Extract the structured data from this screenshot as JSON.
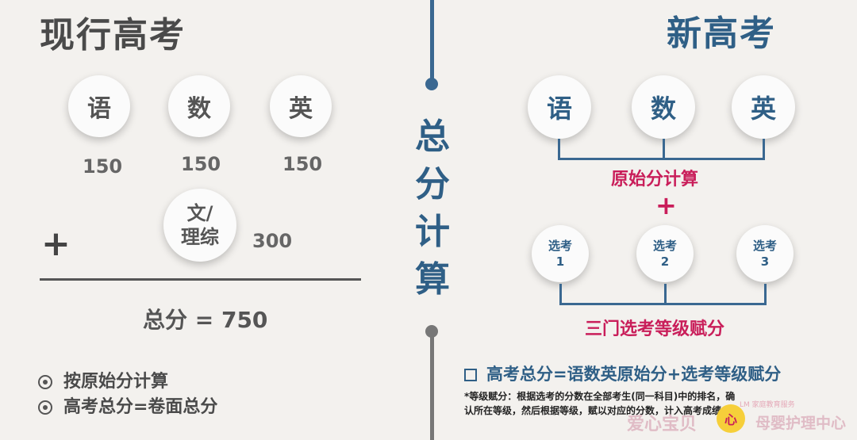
{
  "left": {
    "title": "现行高考",
    "subjects": [
      {
        "label": "语",
        "score": "150"
      },
      {
        "label": "数",
        "score": "150"
      },
      {
        "label": "英",
        "score": "150"
      }
    ],
    "plus": "+",
    "combo_line1": "文/",
    "combo_line2": "理综",
    "combo_score": "300",
    "total": "总分 = 750",
    "notes": [
      "按原始分计算",
      "高考总分=卷面总分"
    ]
  },
  "center": {
    "chars": [
      "总",
      "分",
      "计",
      "算"
    ]
  },
  "right": {
    "title": "新高考",
    "subjects": [
      "语",
      "数",
      "英"
    ],
    "raw_label": "原始分计算",
    "plus": "+",
    "electives": [
      {
        "line1": "选考",
        "line2": "1"
      },
      {
        "line1": "选考",
        "line2": "2"
      },
      {
        "line1": "选考",
        "line2": "3"
      }
    ],
    "elective_label": "三门选考等级赋分",
    "formula": "高考总分=语数英原始分+选考等级赋分",
    "explain_line1": "*等级赋分：根据选考的分数在全部考生(同一科目)中的排名，确",
    "explain_line2": "认所在等级，然后根据等级，赋以对应的分数，计入高考成绩。"
  },
  "watermark": {
    "left_text": "爱心宝贝",
    "right_text": "母婴护理中心",
    "small_text": "LM 家庭教育服务",
    "logo_text": "心"
  }
}
